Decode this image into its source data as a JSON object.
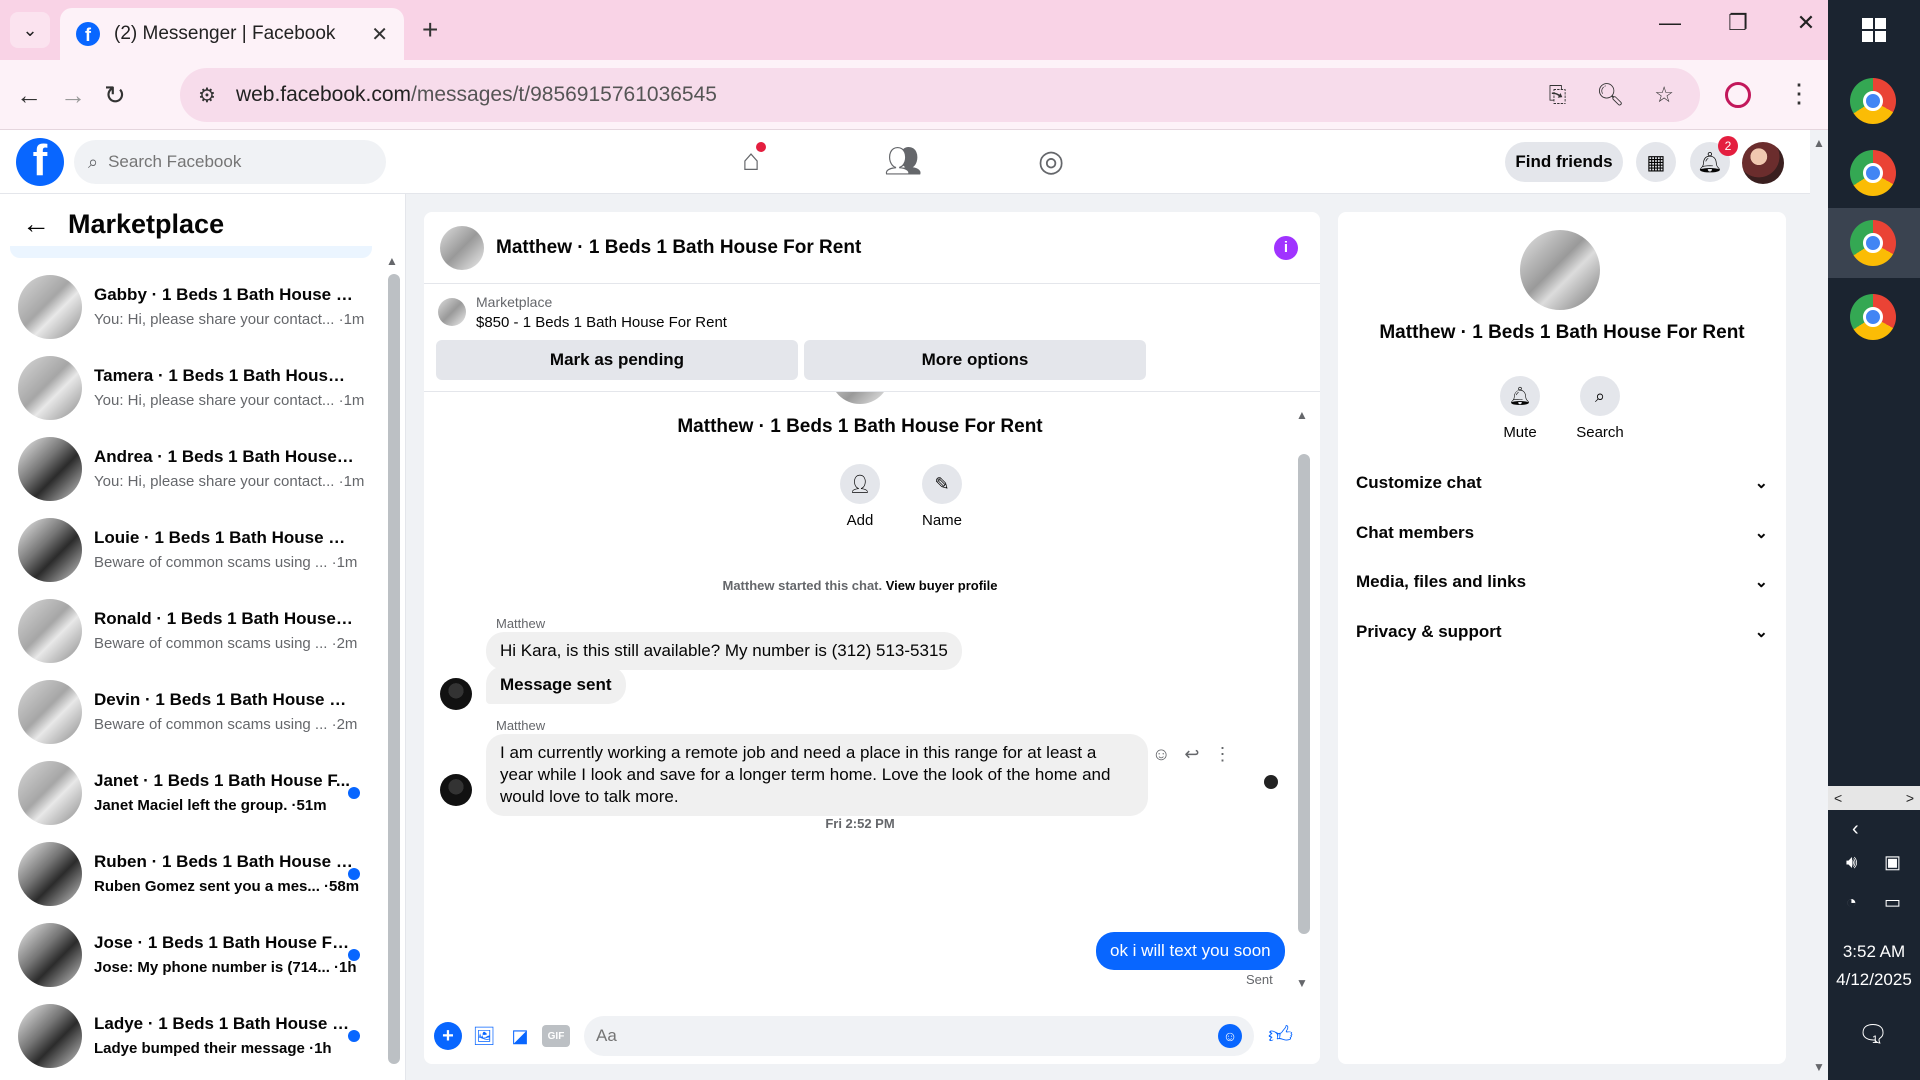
{
  "browser": {
    "tab_title": "(2) Messenger | Facebook",
    "url_prefix": "web.facebook.com",
    "url_path": "/messages/t/9856915761036545"
  },
  "fb_nav": {
    "search_placeholder": "Search Facebook",
    "find_friends": "Find friends",
    "notifications_count": "2"
  },
  "sidebar": {
    "title": "Marketplace",
    "conversations": [
      {
        "name": "Gabby · 1 Beds 1 Bath House Fo...",
        "snippet": "You: Hi, please share your contact... ·1m",
        "unread": false,
        "thumb": "light"
      },
      {
        "name": "Tamera · 1 Beds 1 Bath House F...",
        "snippet": "You: Hi, please share your contact... ·1m",
        "unread": false,
        "thumb": "light"
      },
      {
        "name": "Andrea · 1 Beds 1 Bath House F...",
        "snippet": "You: Hi, please share your contact... ·1m",
        "unread": false,
        "thumb": "dark"
      },
      {
        "name": "Louie · 1 Beds 1 Bath House For ...",
        "snippet": "Beware of common scams using ... ·1m",
        "unread": false,
        "thumb": "dark"
      },
      {
        "name": "Ronald · 1 Beds 1 Bath House Fo...",
        "snippet": "Beware of common scams using ... ·2m",
        "unread": false,
        "thumb": "light"
      },
      {
        "name": "Devin · 1 Beds 1 Bath House For...",
        "snippet": "Beware of common scams using ... ·2m",
        "unread": false,
        "thumb": "light"
      },
      {
        "name": "Janet · 1 Beds 1 Bath House F...",
        "snippet": "Janet Maciel left the group. ·51m",
        "unread": true,
        "thumb": "light"
      },
      {
        "name": "Ruben · 1 Beds 1 Bath House F...",
        "snippet": "Ruben Gomez sent you a mes... ·58m",
        "unread": true,
        "thumb": "dark"
      },
      {
        "name": "Jose · 1 Beds 1 Bath House For...",
        "snippet": "Jose: My phone number is (714... ·1h",
        "unread": true,
        "thumb": "dark"
      },
      {
        "name": "Ladye · 1 Beds 1 Bath House F...",
        "snippet": "Ladye bumped their message ·1h",
        "unread": true,
        "thumb": "dark"
      }
    ]
  },
  "chat": {
    "header_name": "Matthew · 1 Beds 1 Bath House For Rent",
    "marketplace_label": "Marketplace",
    "listing": "$850 - 1 Beds 1 Bath House For Rent",
    "mark_pending": "Mark as pending",
    "more_options": "More options",
    "center_name": "Matthew · 1 Beds 1 Bath House For Rent",
    "add_label": "Add",
    "name_label": "Name",
    "started_text": "Matthew started this chat.",
    "view_buyer_profile": "View buyer profile",
    "sender1": "Matthew",
    "msg1": "Hi Kara, is this still available? My number is (312) 513-5315",
    "msg2": "Message sent",
    "sender2": "Matthew",
    "msg3": "I am currently working a remote job and need a place in this range for at least a year while I look and save for a longer term home. Love the look of the home and would love to talk more.",
    "timestamp": "Fri 2:52 PM",
    "my_msg": "ok i will text you soon",
    "sent_label": "Sent",
    "input_placeholder": "Aa"
  },
  "right_panel": {
    "name": "Matthew · 1 Beds 1 Bath House For Rent",
    "mute": "Mute",
    "search": "Search",
    "sections": [
      "Customize chat",
      "Chat members",
      "Media, files and links",
      "Privacy & support"
    ]
  },
  "taskbar": {
    "time": "3:52 AM",
    "date": "4/12/2025",
    "notification_count": "1"
  }
}
